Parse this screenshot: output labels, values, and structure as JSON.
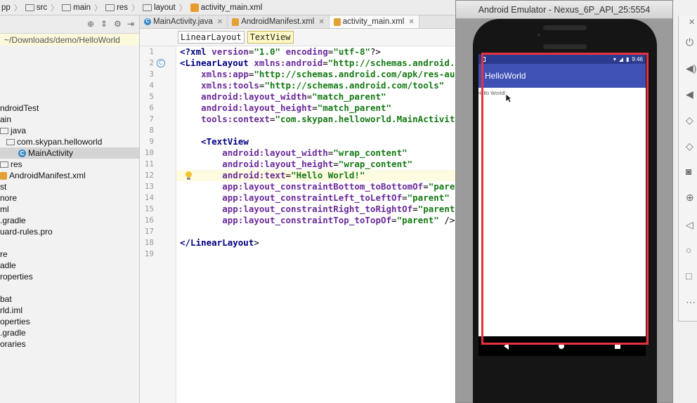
{
  "breadcrumbs": [
    "pp",
    "src",
    "main",
    "res",
    "layout",
    "activity_main.xml"
  ],
  "project": {
    "path": "~/Downloads/demo/HelloWorld",
    "items": [
      {
        "label": "ndroidTest",
        "indent": 0,
        "icon": "none"
      },
      {
        "label": "ain",
        "indent": 0,
        "icon": "none"
      },
      {
        "label": "java",
        "indent": 0,
        "icon": "folder"
      },
      {
        "label": "com.skypan.helloworld",
        "indent": 1,
        "icon": "folder"
      },
      {
        "label": "MainActivity",
        "indent": 2,
        "icon": "class",
        "selected": true
      },
      {
        "label": "res",
        "indent": 0,
        "icon": "folder"
      },
      {
        "label": "AndroidManifest.xml",
        "indent": 0,
        "icon": "xml"
      },
      {
        "label": "st",
        "indent": 0,
        "icon": "none"
      },
      {
        "label": "nore",
        "indent": 0,
        "icon": "none"
      },
      {
        "label": "ml",
        "indent": 0,
        "icon": "none"
      },
      {
        "label": ".gradle",
        "indent": 0,
        "icon": "none"
      },
      {
        "label": "uard-rules.pro",
        "indent": 0,
        "icon": "none"
      },
      {
        "label": "",
        "indent": 0,
        "icon": "none"
      },
      {
        "label": "re",
        "indent": 0,
        "icon": "none"
      },
      {
        "label": "adle",
        "indent": 0,
        "icon": "none"
      },
      {
        "label": "roperties",
        "indent": 0,
        "icon": "none"
      },
      {
        "label": "",
        "indent": 0,
        "icon": "none"
      },
      {
        "label": "bat",
        "indent": 0,
        "icon": "none"
      },
      {
        "label": "rld.iml",
        "indent": 0,
        "icon": "none"
      },
      {
        "label": "operties",
        "indent": 0,
        "icon": "none"
      },
      {
        "label": ".gradle",
        "indent": 0,
        "icon": "none"
      },
      {
        "label": "oraries",
        "indent": 0,
        "icon": "none"
      }
    ]
  },
  "tabs": [
    {
      "label": "MainActivity.java",
      "icon": "class",
      "active": false
    },
    {
      "label": "AndroidManifest.xml",
      "icon": "xml",
      "active": false
    },
    {
      "label": "activity_main.xml",
      "icon": "xml",
      "active": true
    }
  ],
  "xml_path": [
    "LinearLayout",
    "TextView"
  ],
  "code": {
    "current_line": 12,
    "lines": [
      {
        "n": "1",
        "text": "<?xml version=\"1.0\" encoding=\"utf-8\"?>"
      },
      {
        "n": "2",
        "text": "<LinearLayout xmlns:android=\"http://schemas.android."
      },
      {
        "n": "3",
        "text": "    xmlns:app=\"http://schemas.android.com/apk/res-au"
      },
      {
        "n": "4",
        "text": "    xmlns:tools=\"http://schemas.android.com/tools\""
      },
      {
        "n": "5",
        "text": "    android:layout_width=\"match_parent\""
      },
      {
        "n": "6",
        "text": "    android:layout_height=\"match_parent\""
      },
      {
        "n": "7",
        "text": "    tools:context=\"com.skypan.helloworld.MainActivit"
      },
      {
        "n": "8",
        "text": ""
      },
      {
        "n": "9",
        "text": "    <TextView"
      },
      {
        "n": "10",
        "text": "        android:layout_width=\"wrap_content\""
      },
      {
        "n": "11",
        "text": "        android:layout_height=\"wrap_content\""
      },
      {
        "n": "12",
        "text": "        android:text=\"Hello World!\""
      },
      {
        "n": "13",
        "text": "        app:layout_constraintBottom_toBottomOf=\"pare"
      },
      {
        "n": "14",
        "text": "        app:layout_constraintLeft_toLeftOf=\"parent\""
      },
      {
        "n": "15",
        "text": "        app:layout_constraintRight_toRightOf=\"parent"
      },
      {
        "n": "16",
        "text": "        app:layout_constraintTop_toTopOf=\"parent\" />"
      },
      {
        "n": "17",
        "text": ""
      },
      {
        "n": "18",
        "text": "</LinearLayout>"
      },
      {
        "n": "19",
        "text": ""
      }
    ]
  },
  "emulator": {
    "title": "Android Emulator - Nexus_6P_API_25:5554",
    "time": "9:46",
    "app_title": "HelloWorld",
    "text_view": "Hello World!"
  },
  "colors": {
    "app_bar": "#3f51b5",
    "status_bar": "#2c3b8f",
    "highlight_box": "#e8313d"
  },
  "side_toolbar": [
    "power-icon",
    "volume-up-icon",
    "volume-down-icon",
    "rotate-left-icon",
    "rotate-right-icon",
    "camera-icon",
    "zoom-icon",
    "back-icon",
    "home-icon",
    "overview-icon",
    "more-icon"
  ]
}
